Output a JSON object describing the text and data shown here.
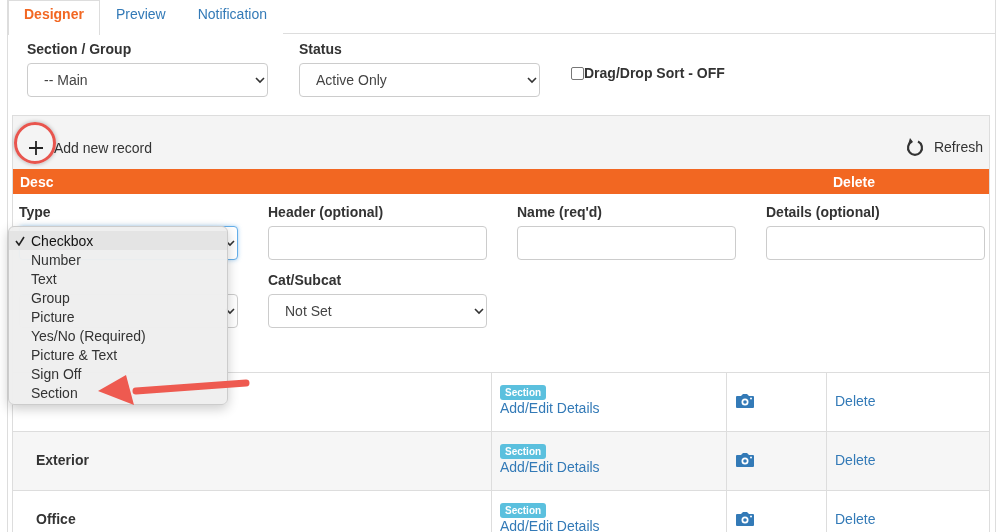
{
  "tabs": [
    {
      "label": "Designer",
      "selected": true
    },
    {
      "label": "Preview",
      "selected": false
    },
    {
      "label": "Notification",
      "selected": false
    }
  ],
  "filters": {
    "section_group": {
      "label": "Section / Group",
      "value": "-- Main"
    },
    "status": {
      "label": "Status",
      "value": "Active Only"
    },
    "drag_drop_sort": {
      "label": "Drag/Drop Sort - OFF",
      "checked": false
    }
  },
  "toolbar": {
    "add": "Add new record",
    "refresh": "Refresh"
  },
  "table_header": {
    "desc": "Desc",
    "delete": "Delete"
  },
  "form": {
    "type": {
      "label": "Type"
    },
    "header": {
      "label": "Header (optional)"
    },
    "name": {
      "label": "Name (req'd)"
    },
    "details": {
      "label": "Details (optional)"
    },
    "cat_subcat": {
      "label": "Cat/Subcat",
      "value": "Not Set"
    }
  },
  "type_menu": {
    "items": [
      {
        "label": "Checkbox",
        "selected": true
      },
      {
        "label": "Number",
        "selected": false
      },
      {
        "label": "Text",
        "selected": false
      },
      {
        "label": "Group",
        "selected": false
      },
      {
        "label": "Picture",
        "selected": false
      },
      {
        "label": "Yes/No (Required)",
        "selected": false
      },
      {
        "label": "Picture & Text",
        "selected": false
      },
      {
        "label": "Sign Off",
        "selected": false
      },
      {
        "label": "Section",
        "selected": false
      }
    ]
  },
  "rows": [
    {
      "tag": "Section",
      "link": "Add/Edit Details",
      "delete": "Delete"
    },
    {
      "name": "Exterior",
      "tag": "Section",
      "link": "Add/Edit Details",
      "delete": "Delete"
    },
    {
      "name": "Office",
      "tag": "Section",
      "link": "Add/Edit Details",
      "delete": "Delete"
    }
  ]
}
